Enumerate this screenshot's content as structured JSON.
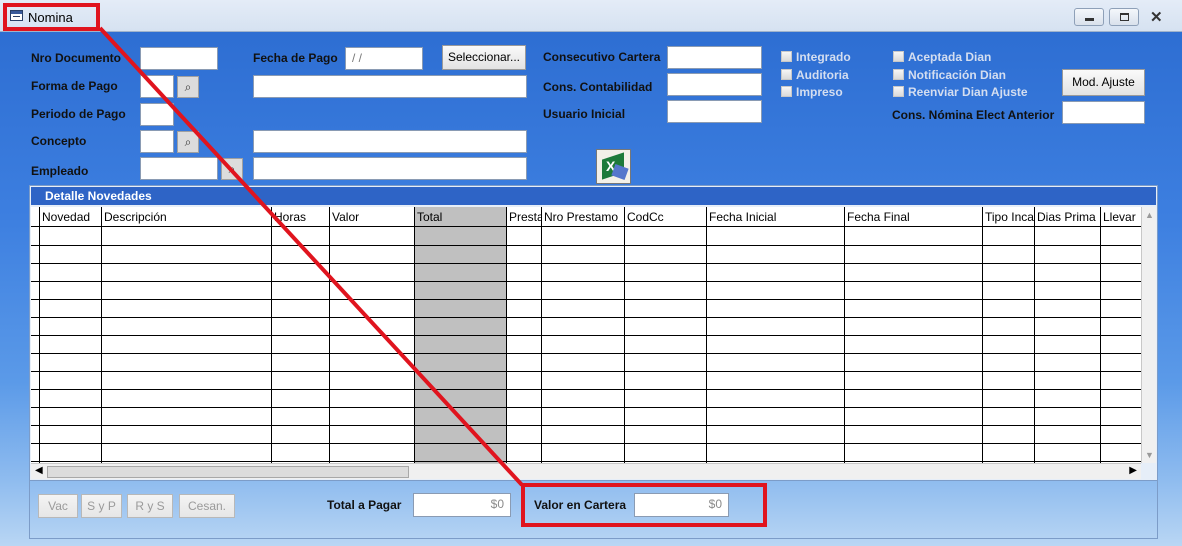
{
  "window": {
    "title": "Nomina",
    "controls": [
      "minimize",
      "maximize",
      "close"
    ]
  },
  "form": {
    "nro_documento": {
      "label": "Nro Documento",
      "value": ""
    },
    "fecha_pago": {
      "label": "Fecha de Pago",
      "value": " / /"
    },
    "seleccionar_button": "Seleccionar...",
    "forma_pago": {
      "label": "Forma de Pago",
      "code": "",
      "description": ""
    },
    "periodo_pago": {
      "label": "Periodo de Pago",
      "value": ""
    },
    "concepto": {
      "label": "Concepto",
      "code": "",
      "description": ""
    },
    "empleado": {
      "label": "Empleado",
      "code": "",
      "description": ""
    },
    "consecutivo_cartera": {
      "label": "Consecutivo Cartera",
      "value": ""
    },
    "cons_contabilidad": {
      "label": "Cons. Contabilidad",
      "value": ""
    },
    "usuario_inicial": {
      "label": "Usuario Inicial",
      "value": ""
    },
    "checkboxes_left": [
      {
        "label": "Integrado",
        "checked": false
      },
      {
        "label": "Auditoria",
        "checked": false
      },
      {
        "label": "Impreso",
        "checked": false
      }
    ],
    "checkboxes_right": [
      {
        "label": "Aceptada Dian",
        "checked": false
      },
      {
        "label": "Notificación Dian",
        "checked": false
      },
      {
        "label": "Reenviar Dian Ajuste",
        "checked": false
      }
    ],
    "mod_ajuste_button": "Mod. Ajuste",
    "cons_nomina_anterior": {
      "label": "Cons. Nómina Elect Anterior",
      "value": ""
    },
    "excel_icon": "excel-export-icon"
  },
  "grid": {
    "caption": "Detalle Novedades",
    "columns": [
      "Novedad",
      "Descripción",
      "Horas",
      "Valor",
      "Total",
      "Presta",
      "Nro Prestamo",
      "CodCc",
      "Fecha Inicial",
      "Fecha Final",
      "Tipo Inca",
      "Dias Prima",
      "Llevar"
    ],
    "rows": 13
  },
  "footer": {
    "buttons": [
      "Vac",
      "S y P",
      "R y S",
      "Cesan."
    ],
    "total_pagar": {
      "label": "Total a Pagar",
      "value": "$0"
    },
    "valor_cartera": {
      "label": "Valor en Cartera",
      "value": "$0"
    }
  },
  "colors": {
    "highlight": "#e0141e",
    "caption_bg": "#2e64c6",
    "total_column_bg": "#c0c0c0"
  }
}
